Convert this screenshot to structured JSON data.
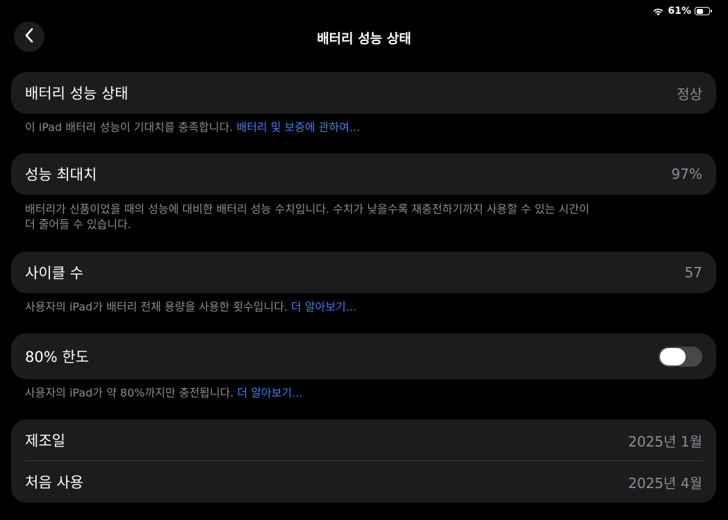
{
  "status_bar": {
    "battery_percent": "61%",
    "battery_level": 0.61
  },
  "nav": {
    "title": "배터리 성능 상태"
  },
  "health": {
    "label": "배터리 성능 상태",
    "value": "정상",
    "footer": "이 iPad 배터리 성능이 기대치를 충족합니다.",
    "footer_link": "배터리 및 보증에 관하여..."
  },
  "max_capacity": {
    "label": "성능 최대치",
    "value": "97%",
    "footer_line1": "배터리가 신품이었을 때의 성능에 대비한 배터리 성능 수치입니다. 수치가 낮을수록 재충전하기까지 사용할 수 있는 시간이",
    "footer_line2": "더 줄어들 수 있습니다."
  },
  "cycle_count": {
    "label": "사이클 수",
    "value": "57",
    "footer": "사용자의 iPad가 배터리 전체 용량을 사용한 횟수입니다.",
    "footer_link": "더 알아보기..."
  },
  "limit_80": {
    "label": "80% 한도",
    "toggle_on": false,
    "footer": "사용자의 iPad가 약 80%까지만 충전됩니다.",
    "footer_link": "더 알아보기..."
  },
  "dates": {
    "manufactured_label": "제조일",
    "manufactured_value": "2025년 1월",
    "first_use_label": "처음 사용",
    "first_use_value": "2025년 4월"
  },
  "colors": {
    "background": "#000000",
    "group": "#1c1c1e",
    "link": "#3b82f6",
    "secondary_text": "#8e8e93"
  },
  "icons": {
    "back": "chevron-left-icon",
    "wifi": "wifi-icon",
    "battery": "battery-icon"
  }
}
